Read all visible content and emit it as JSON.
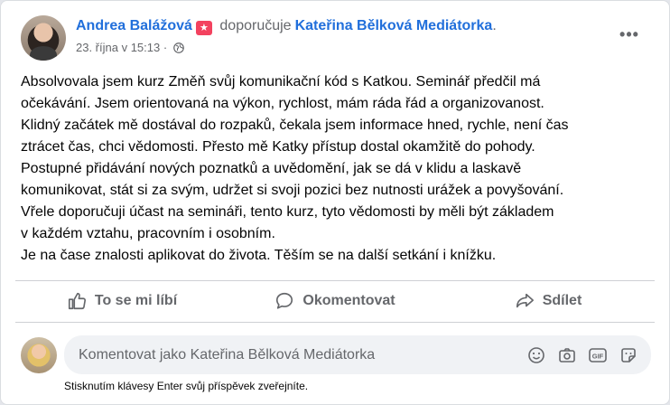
{
  "post": {
    "author": "Andrea Balážová",
    "verb": "doporučuje",
    "page": "Kateřina Bělková Mediátorka",
    "name_suffix": ".",
    "timestamp": "23. října v 15:13",
    "separator": "·",
    "text": "Absolvovala jsem kurz Změň svůj komunikační kód s Katkou. Seminář předčil má\nočekávání. Jsem orientovaná na výkon, rychlost, mám ráda řád a organizovanost.\nKlidný začátek mě dostával do rozpaků, čekala jsem informace hned, rychle, není čas\nztrácet čas, chci vědomosti. Přesto mě Katky přístup dostal okamžitě do pohody.\nPostupné přidávání nových poznatků a uvědomění, jak se dá v klidu a laskavě\nkomunikovat, stát si za svým, udržet si svoji pozici bez nutnosti urážek a povyšování.\nVřele doporučuji účast na semináři, tento kurz, tyto vědomosti by měli být základem\nv každém vztahu, pracovním i osobním.\nJe na čase znalosti aplikovat do života. Těším se na další setkání i knížku."
  },
  "actions": {
    "like": "To se mi líbí",
    "comment": "Okomentovat",
    "share": "Sdílet"
  },
  "comment": {
    "placeholder": "Komentovat jako Kateřina Bělková Mediátorka",
    "hint": "Stisknutím klávesy Enter svůj příspěvek zveřejníte."
  },
  "icons": {
    "recommend_badge": "recommend-star-icon",
    "privacy": "globe-icon",
    "more": "more-dots-icon",
    "like": "thumbs-up-icon",
    "comment": "speech-bubble-icon",
    "share": "share-arrow-icon",
    "emoji": "emoji-icon",
    "camera": "camera-icon",
    "gif": "gif-icon",
    "sticker": "sticker-icon"
  },
  "colors": {
    "link": "#216fdb",
    "muted": "#65676b",
    "badge": "#f3425f"
  }
}
